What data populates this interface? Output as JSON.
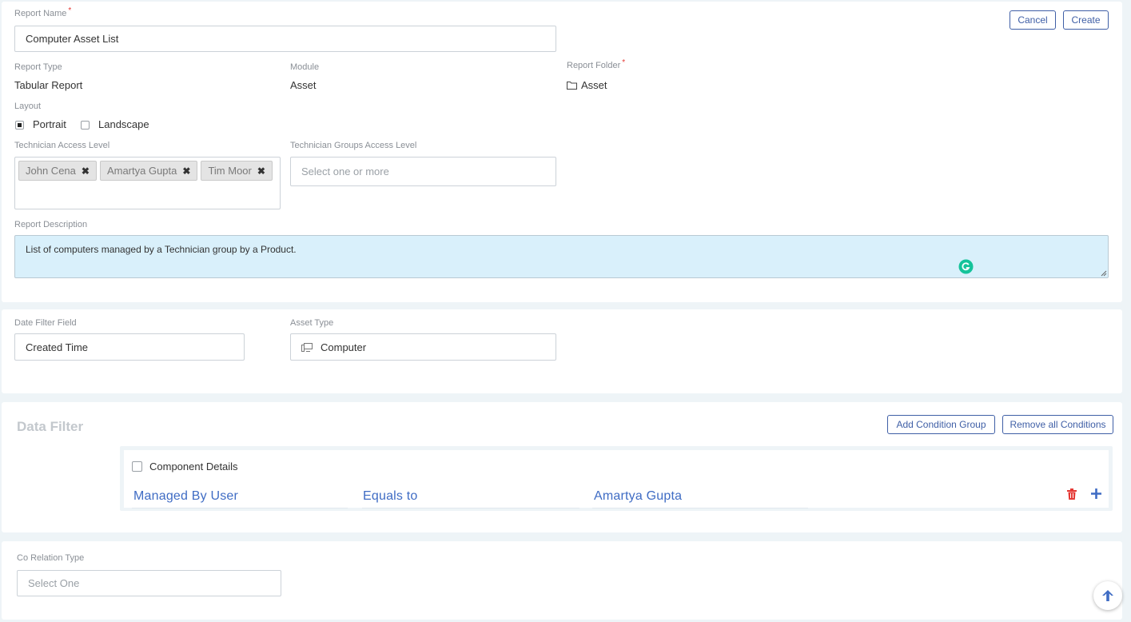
{
  "header": {
    "cancel_label": "Cancel",
    "create_label": "Create"
  },
  "report_name": {
    "label": "Report Name",
    "value": "Computer Asset List"
  },
  "report_type": {
    "label": "Report Type",
    "value": "Tabular Report"
  },
  "module": {
    "label": "Module",
    "value": "Asset"
  },
  "report_folder": {
    "label": "Report Folder",
    "value": "Asset",
    "icon": "folder-icon"
  },
  "layout": {
    "label": "Layout",
    "options": [
      "Portrait",
      "Landscape"
    ],
    "selected": "Portrait"
  },
  "tech_access": {
    "label": "Technician Access Level",
    "tags": [
      "John Cena",
      "Amartya Gupta",
      "Tim Moor"
    ]
  },
  "tech_groups": {
    "label": "Technician Groups Access Level",
    "placeholder": "Select one or more"
  },
  "description": {
    "label": "Report Description",
    "value": "List of computers managed by a Technician group by a Product."
  },
  "date_filter": {
    "label": "Date Filter Field",
    "value": "Created Time"
  },
  "asset_type": {
    "label": "Asset Type",
    "value": "Computer",
    "icon": "computer-icon"
  },
  "data_filter": {
    "title": "Data Filter",
    "add_group_label": "Add Condition Group",
    "remove_all_label": "Remove all Conditions",
    "group_label": "Component Details",
    "condition": {
      "field": "Managed By User",
      "operator": "Equals to",
      "value": "Amartya Gupta"
    }
  },
  "co_relation": {
    "label": "Co Relation Type",
    "placeholder": "Select One"
  },
  "colors": {
    "accent": "#3f5fa6",
    "link": "#3f6cc4",
    "danger": "#e53935",
    "grammarly": "#15c39a",
    "desc_bg": "#d9f0fb"
  }
}
